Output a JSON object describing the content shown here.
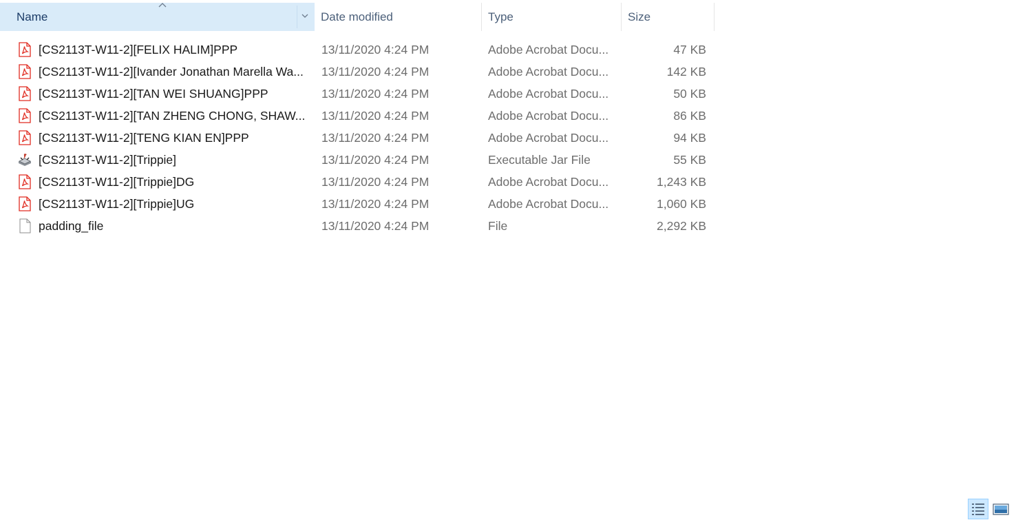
{
  "columns": {
    "name": "Name",
    "date": "Date modified",
    "type": "Type",
    "size": "Size"
  },
  "sort": {
    "column": "name",
    "direction": "ascending"
  },
  "files": [
    {
      "name": "[CS2113T-W11-2][FELIX HALIM]PPP",
      "date": "13/11/2020 4:24 PM",
      "type": "Adobe Acrobat Docu...",
      "size": "47 KB",
      "icon": "pdf-icon"
    },
    {
      "name": "[CS2113T-W11-2][Ivander Jonathan Marella Wa...",
      "date": "13/11/2020 4:24 PM",
      "type": "Adobe Acrobat Docu...",
      "size": "142 KB",
      "icon": "pdf-icon"
    },
    {
      "name": "[CS2113T-W11-2][TAN WEI SHUANG]PPP",
      "date": "13/11/2020 4:24 PM",
      "type": "Adobe Acrobat Docu...",
      "size": "50 KB",
      "icon": "pdf-icon"
    },
    {
      "name": "[CS2113T-W11-2][TAN ZHENG CHONG, SHAW...",
      "date": "13/11/2020 4:24 PM",
      "type": "Adobe Acrobat Docu...",
      "size": "86 KB",
      "icon": "pdf-icon"
    },
    {
      "name": "[CS2113T-W11-2][TENG KIAN EN]PPP",
      "date": "13/11/2020 4:24 PM",
      "type": "Adobe Acrobat Docu...",
      "size": "94 KB",
      "icon": "pdf-icon"
    },
    {
      "name": "[CS2113T-W11-2][Trippie]",
      "date": "13/11/2020 4:24 PM",
      "type": "Executable Jar File",
      "size": "55 KB",
      "icon": "jar-icon"
    },
    {
      "name": "[CS2113T-W11-2][Trippie]DG",
      "date": "13/11/2020 4:24 PM",
      "type": "Adobe Acrobat Docu...",
      "size": "1,243 KB",
      "icon": "pdf-icon"
    },
    {
      "name": "[CS2113T-W11-2][Trippie]UG",
      "date": "13/11/2020 4:24 PM",
      "type": "Adobe Acrobat Docu...",
      "size": "1,060 KB",
      "icon": "pdf-icon"
    },
    {
      "name": "padding_file",
      "date": "13/11/2020 4:24 PM",
      "type": "File",
      "size": "2,292 KB",
      "icon": "blank-file-icon"
    }
  ],
  "status_bar": {
    "view_buttons": [
      "details-view-icon",
      "large-icons-view-icon"
    ],
    "active_view": "details"
  },
  "colors": {
    "pdf_red": "#e02b20",
    "selected_header": "#d9ebf9",
    "active_view_bg": "#cce8ff"
  }
}
